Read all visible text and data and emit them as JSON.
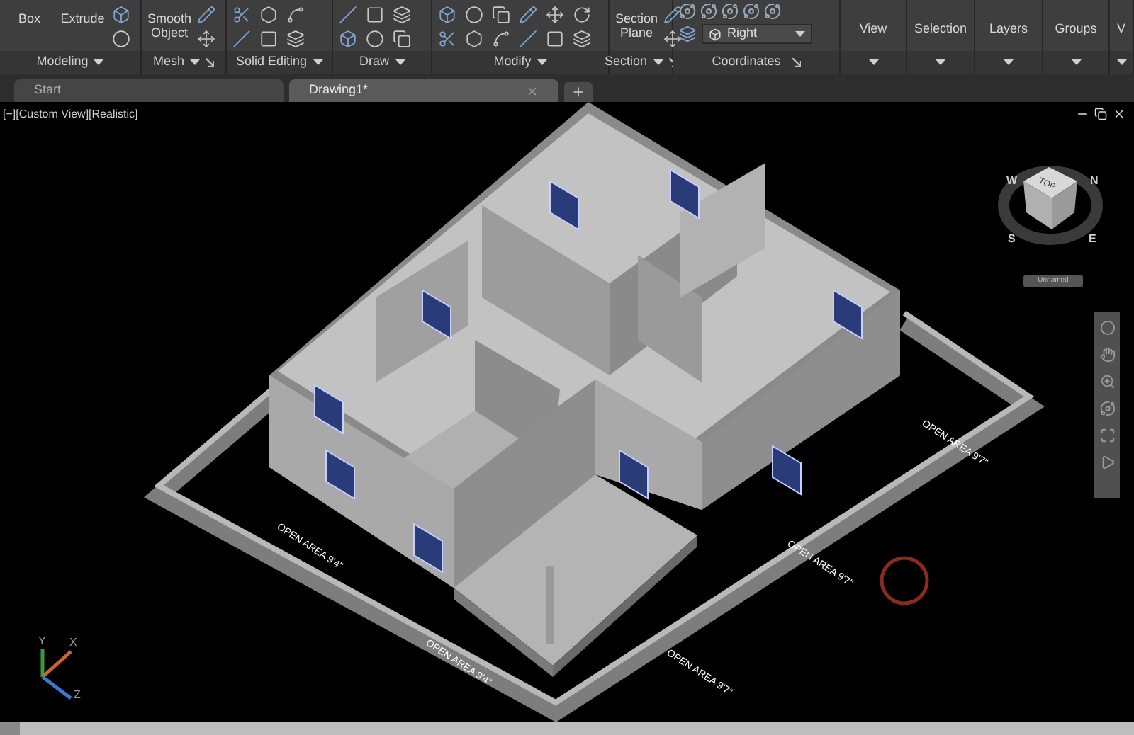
{
  "ribbon": {
    "panels": [
      {
        "kind": "tools",
        "title": "Modeling",
        "buttons": [
          "Box",
          "Extrude"
        ],
        "launcher": false
      },
      {
        "kind": "tools",
        "title": "Mesh",
        "buttons": [
          "Smooth Object"
        ],
        "launcher": true
      },
      {
        "kind": "tools",
        "title": "Solid Editing",
        "launcher": false
      },
      {
        "kind": "tools",
        "title": "Draw",
        "launcher": false
      },
      {
        "kind": "tools",
        "title": "Modify",
        "launcher": false
      },
      {
        "kind": "tools",
        "title": "Section",
        "buttons": [
          "Section Plane"
        ],
        "launcher": true
      },
      {
        "kind": "coords",
        "title": "Coordinates",
        "dropdown": "Right",
        "launcher": true
      },
      {
        "kind": "big",
        "label": "View"
      },
      {
        "kind": "big",
        "label": "Selection"
      },
      {
        "kind": "big",
        "label": "Layers"
      },
      {
        "kind": "big",
        "label": "Groups"
      },
      {
        "kind": "big",
        "label": "V"
      }
    ]
  },
  "tabs": [
    {
      "label": "Start",
      "selected": false,
      "closable": false
    },
    {
      "label": "Drawing1*",
      "selected": true,
      "closable": true
    }
  ],
  "viewport": {
    "label": "[−][Custom View][Realistic]",
    "viewcube": {
      "face": "TOP",
      "compass": [
        "W",
        "N",
        "S",
        "E"
      ],
      "ucs_menu": "Unnamed"
    },
    "area_labels": [
      "OPEN AREA 9'7\"",
      "OPEN AREA 9'4\"",
      "OPEN AREA 9'7\"",
      "OPEN AREA 9'4\"",
      "OPEN AREA 9'7\""
    ],
    "ucs_axes": [
      "Y",
      "X",
      "Z"
    ]
  }
}
